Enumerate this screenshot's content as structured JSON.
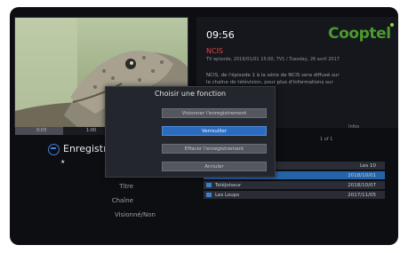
{
  "player": {
    "time_start": "0:03",
    "time_end": "1:00",
    "progress_percent": 28
  },
  "info": {
    "clock": "09:56",
    "brand": "Cooptel",
    "program_title": "NCIS",
    "program_meta": "TV episode, 2016/01/01 15:00, TV1 / Tuesday, 26 avril 2017",
    "program_desc": "NCIS, de l'épisode 1 à la série de NCIS sera diffusé sur\nla chaîne de télévision, pour plus d'informations sur\nle programme.",
    "right_hint": "Infos",
    "page_hint": "1 of 1"
  },
  "recordings": {
    "title": "Enregistrements",
    "star": "★",
    "labels": [
      "Titre",
      "Chaîne",
      "Visionné/Non"
    ],
    "items": [
      {
        "name": "",
        "date": "Les 10"
      },
      {
        "name": "",
        "date": "2018/10/01"
      },
      {
        "name": "TeléJoiseur",
        "date": "2018/10/07"
      },
      {
        "name": "Les Loups",
        "date": "2017/11/05"
      }
    ]
  },
  "dialog": {
    "title": "Choisir une fonction",
    "options": [
      "Visionner l'enregistrement",
      "Verrouiller",
      "Effacer l'enregistrement",
      "Annuler"
    ],
    "selected_index": 1
  }
}
